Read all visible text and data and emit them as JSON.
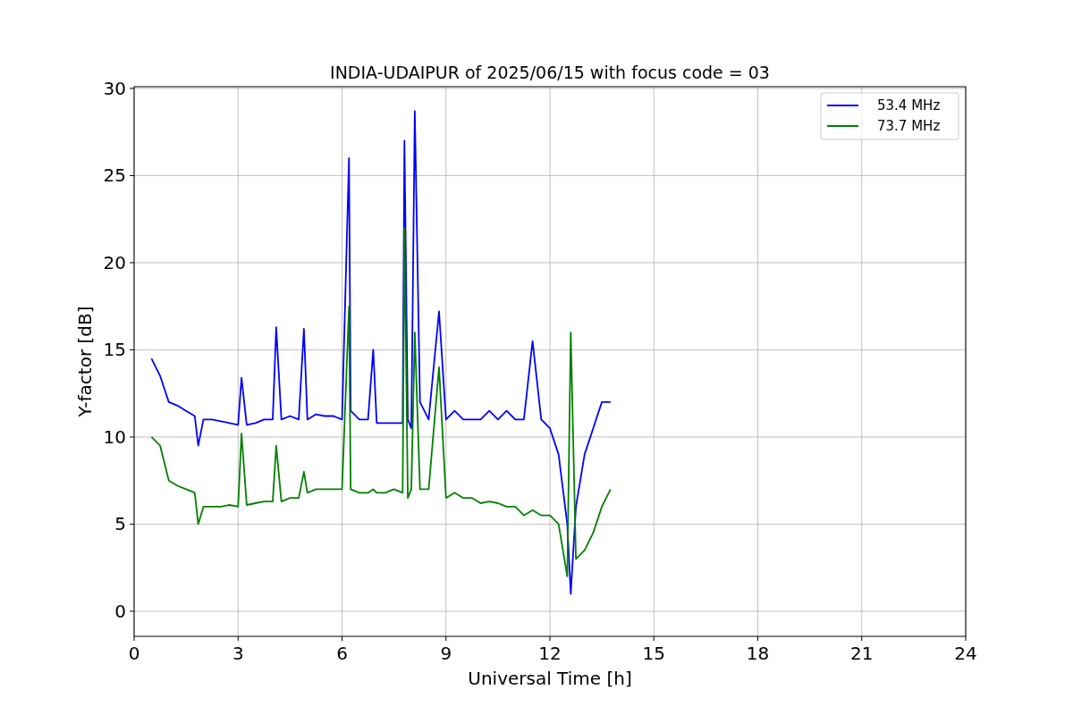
{
  "figure": {
    "chart_data": {
      "type": "line",
      "title": "INDIA-UDAIPUR of 2025/06/15 with focus code = 03",
      "xlabel": "Universal Time [h]",
      "ylabel": "Y-factor [dB]",
      "x": [
        0.5,
        0.75,
        1,
        1.25,
        1.5,
        1.75,
        1.85,
        2,
        2.25,
        2.5,
        2.75,
        3,
        3.1,
        3.25,
        3.5,
        3.75,
        4,
        4.1,
        4.25,
        4.5,
        4.75,
        4.9,
        5,
        5.25,
        5.5,
        5.75,
        6,
        6.2,
        6.25,
        6.5,
        6.75,
        6.9,
        7,
        7.25,
        7.5,
        7.75,
        7.8,
        7.9,
        8,
        8.1,
        8.25,
        8.5,
        8.8,
        9,
        9.25,
        9.5,
        9.75,
        10,
        10.25,
        10.5,
        10.75,
        11,
        11.25,
        11.5,
        11.75,
        12,
        12.25,
        12.5,
        12.6,
        12.75,
        13,
        13.25,
        13.5,
        13.75
      ],
      "series": [
        {
          "name": "53.4 MHz",
          "color": "#0000ff",
          "values": [
            14.5,
            13.5,
            12,
            11.8,
            11.5,
            11.2,
            9.5,
            11,
            11,
            10.9,
            10.8,
            10.7,
            13.4,
            10.7,
            10.8,
            11,
            11,
            16.3,
            11,
            11.2,
            11,
            16.2,
            11,
            11.3,
            11.2,
            11.2,
            11,
            26,
            11.5,
            11,
            11,
            15,
            10.8,
            10.8,
            10.8,
            10.8,
            27,
            11,
            10.5,
            28.7,
            12,
            11,
            17.2,
            11,
            11.5,
            11,
            11,
            11,
            11.5,
            11,
            11.5,
            11,
            11,
            15.5,
            11,
            10.5,
            9,
            5,
            1,
            6,
            9,
            10.5,
            12,
            12
          ]
        },
        {
          "name": "73.7 MHz",
          "color": "#008000",
          "values": [
            10,
            9.5,
            7.5,
            7.2,
            7,
            6.8,
            5,
            6,
            6,
            6,
            6.1,
            6,
            10.2,
            6.1,
            6.2,
            6.3,
            6.3,
            9.5,
            6.3,
            6.5,
            6.5,
            8,
            6.8,
            7,
            7,
            7,
            7,
            17.5,
            7,
            6.8,
            6.8,
            7,
            6.8,
            6.8,
            7,
            6.8,
            22,
            6.5,
            7,
            16,
            7,
            7,
            14,
            6.5,
            6.8,
            6.5,
            6.5,
            6.2,
            6.3,
            6.2,
            6,
            6,
            5.5,
            5.8,
            5.5,
            5.5,
            5,
            2,
            16,
            3,
            3.5,
            4.5,
            6,
            7
          ]
        }
      ],
      "xlim": [
        0,
        24
      ],
      "ylim": [
        -1.44,
        30.1
      ],
      "xticks": [
        0,
        3,
        6,
        9,
        12,
        15,
        18,
        21,
        24
      ],
      "yticks": [
        0,
        5,
        10,
        15,
        20,
        25,
        30
      ],
      "grid": true,
      "legend": true
    }
  }
}
